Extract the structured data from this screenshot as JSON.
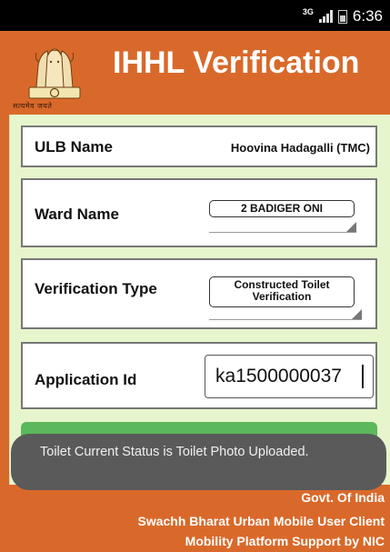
{
  "status_bar": {
    "network": "3G",
    "time": "6:36"
  },
  "header": {
    "title": "IHHL Verification",
    "emblem_caption": "सत्यमेव जयते"
  },
  "form": {
    "ulb": {
      "label": "ULB Name",
      "value": "Hoovina Hadagalli (TMC)"
    },
    "ward": {
      "label": "Ward Name",
      "value": "2 BADIGER ONI"
    },
    "verification_type": {
      "label": "Verification Type",
      "value_line1": "Constructed Toilet",
      "value_line2": "Verification"
    },
    "application_id": {
      "label": "Application Id",
      "value": "ka1500000037"
    }
  },
  "toast": {
    "message": "Toilet Current Status is Toilet Photo Uploaded."
  },
  "footer": {
    "line1": "Govt. Of India",
    "line2": "Swachh Bharat Urban Mobile User Client",
    "line3": "Mobility Platform Support by NIC"
  },
  "colors": {
    "header_bg": "#d9692a",
    "form_bg": "#e7f5cd",
    "button_green": "#5cb85c",
    "toast_bg": "#5a5a5a"
  },
  "icons": {
    "emblem": "national-emblem-icon",
    "signal": "signal-strength-icon",
    "battery": "battery-icon"
  }
}
